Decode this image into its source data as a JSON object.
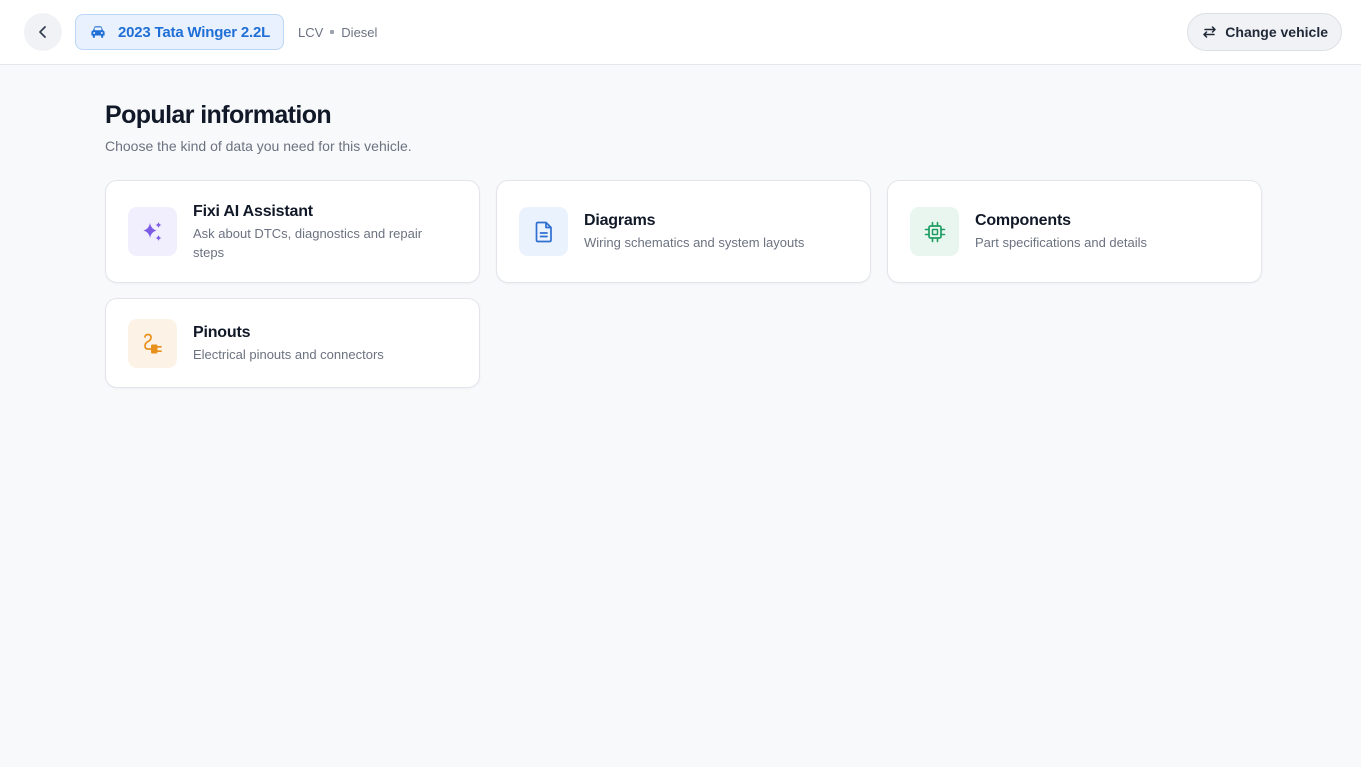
{
  "header": {
    "back_icon": "chevron-left-icon",
    "vehicle_icon": "car-icon",
    "vehicle_label": "2023 Tata Winger 2.2L",
    "vehicle_type": "LCV",
    "fuel_type": "Diesel",
    "change_icon": "swap-arrows-icon",
    "change_label": "Change vehicle"
  },
  "main": {
    "title": "Popular information",
    "subtitle": "Choose the kind of data you need for this vehicle."
  },
  "cards": [
    {
      "title": "Fixi AI Assistant",
      "description": "Ask about DTCs, diagnostics and repair steps",
      "icon": "sparkles-icon",
      "color": "#7c5ce6",
      "bg": "#f1eefd"
    },
    {
      "title": "Diagrams",
      "description": "Wiring schematics and system layouts",
      "icon": "document-icon",
      "color": "#2f6fd0",
      "bg": "#eaf2fd"
    },
    {
      "title": "Components",
      "description": "Part specifications and details",
      "icon": "chip-icon",
      "color": "#1f9d62",
      "bg": "#e8f6ef"
    },
    {
      "title": "Pinouts",
      "description": "Electrical pinouts and connectors",
      "icon": "plug-icon",
      "color": "#e8901c",
      "bg": "#fdf2e6"
    }
  ]
}
